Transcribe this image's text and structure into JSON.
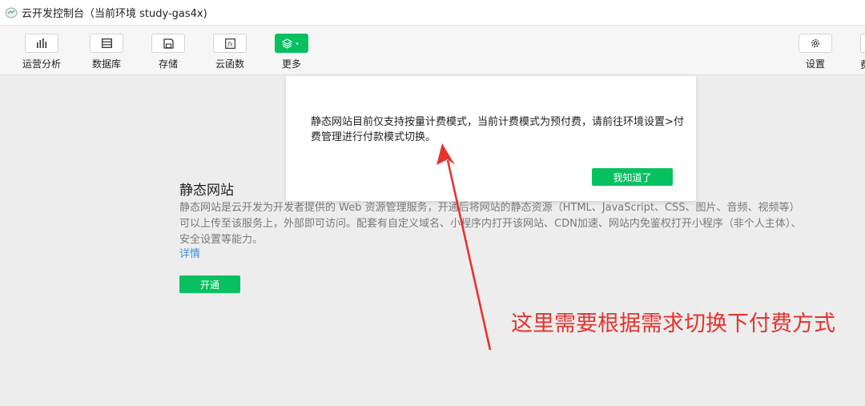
{
  "window": {
    "title": "云开发控制台（当前环境 study-gas4x)"
  },
  "toolbar": {
    "items": [
      {
        "label": "运营分析",
        "icon": "bar-chart-icon"
      },
      {
        "label": "数据库",
        "icon": "database-icon"
      },
      {
        "label": "存储",
        "icon": "save-icon"
      },
      {
        "label": "云函数",
        "icon": "function-icon"
      },
      {
        "label": "更多",
        "icon": "layers-icon"
      },
      {
        "label": "设置",
        "icon": "gear-icon"
      }
    ],
    "partial_label": "费"
  },
  "main": {
    "section_title": "静态网站",
    "description": "静态网站是云开发为开发者提供的 Web 资源管理服务，开通后将网站的静态资源（HTML、JavaScript、CSS、图片、音频、视频等）可以上传至该服务上，外部即可访问。配套有自定义域名、小程序内打开该网站、CDN加速、网站内免鉴权打开小程序（非个人主体）、安全设置等能力。",
    "more_link": "详情",
    "open_button": "开通"
  },
  "dialog": {
    "message": "静态网站目前仅支持按量计费模式，当前计费模式为预付费，请前往环境设置>付费管理进行付款模式切换。",
    "confirm_button": "我知道了"
  },
  "annotation": {
    "text": "这里需要根据需求切换下付费方式",
    "color": "#e8322e"
  },
  "colors": {
    "accent": "#07c160",
    "link": "#3c8fd6"
  }
}
